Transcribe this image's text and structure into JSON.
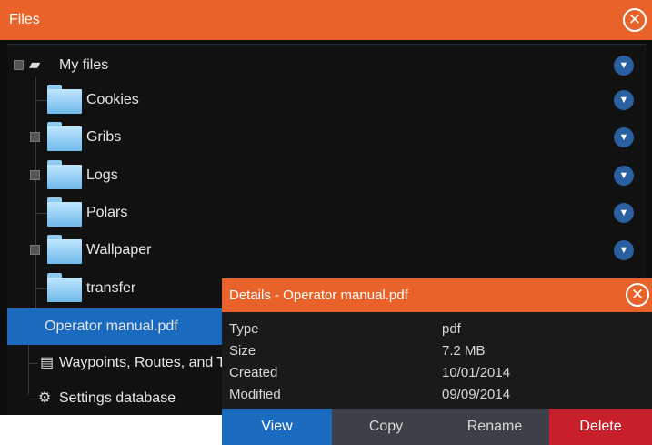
{
  "files": {
    "title": "Files",
    "close_icon": "close-circle-icon",
    "tree": [
      {
        "label": "My files",
        "icon": "drive-icon"
      },
      {
        "label": "Cookies",
        "icon": "folder-icon"
      },
      {
        "label": "Gribs",
        "icon": "folder-icon"
      },
      {
        "label": "Logs",
        "icon": "folder-icon"
      },
      {
        "label": "Polars",
        "icon": "folder-icon"
      },
      {
        "label": "Wallpaper",
        "icon": "folder-icon"
      },
      {
        "label": "transfer",
        "icon": "folder-icon"
      },
      {
        "label": "Operator manual.pdf",
        "icon": "file-icon"
      },
      {
        "label": "Waypoints, Routes, and Tracks",
        "icon": "database-icon"
      },
      {
        "label": "Settings database",
        "icon": "settings-database-icon"
      }
    ]
  },
  "details": {
    "title": "Details - Operator manual.pdf",
    "rows": [
      {
        "key": "Type",
        "value": "pdf"
      },
      {
        "key": "Size",
        "value": "7.2 MB"
      },
      {
        "key": "Created",
        "value": "10/01/2014"
      },
      {
        "key": "Modified",
        "value": "09/09/2014"
      }
    ],
    "actions": {
      "view": "View",
      "copy": "Copy",
      "rename": "Rename",
      "delete": "Delete"
    }
  },
  "colors": {
    "accent": "#e8622a",
    "selection": "#1a6bbf",
    "delete": "#c8202a",
    "button": "#3c4147"
  }
}
